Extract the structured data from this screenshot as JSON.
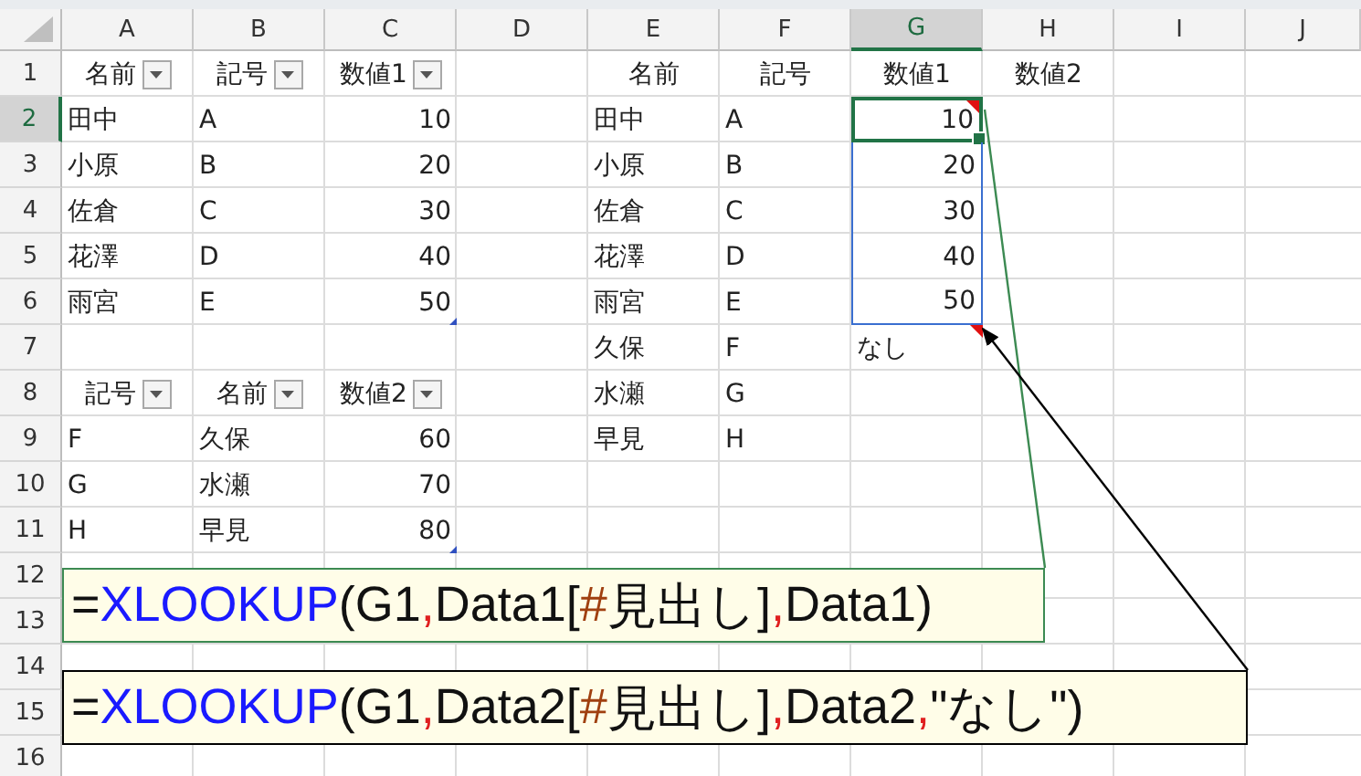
{
  "columns": [
    {
      "label": "A",
      "selected": false
    },
    {
      "label": "B",
      "selected": false
    },
    {
      "label": "C",
      "selected": false
    },
    {
      "label": "D",
      "selected": false
    },
    {
      "label": "E",
      "selected": false
    },
    {
      "label": "F",
      "selected": false
    },
    {
      "label": "G",
      "selected": true
    },
    {
      "label": "H",
      "selected": false
    },
    {
      "label": "I",
      "selected": false
    },
    {
      "label": "J",
      "selected": false
    }
  ],
  "rows": [
    {
      "label": "1",
      "selected": false,
      "cells": {
        "A": {
          "text": "名前",
          "kind": "header",
          "filter": true,
          "selected": false
        },
        "B": {
          "text": "記号",
          "kind": "header",
          "filter": true,
          "selected": false
        },
        "C": {
          "text": "数値1",
          "kind": "header",
          "filter": true,
          "selected": false
        },
        "E": {
          "text": "名前",
          "kind": "header",
          "selected": false
        },
        "F": {
          "text": "記号",
          "kind": "header",
          "selected": false
        },
        "G": {
          "text": "数値1",
          "kind": "header",
          "selected": false
        },
        "H": {
          "text": "数値2",
          "kind": "header",
          "selected": false
        }
      }
    },
    {
      "label": "2",
      "selected": true,
      "cells": {
        "A": {
          "text": "田中",
          "kind": "text",
          "selected": false
        },
        "B": {
          "text": "A",
          "kind": "text",
          "selected": false
        },
        "C": {
          "text": "10",
          "kind": "number",
          "selected": false
        },
        "E": {
          "text": "田中",
          "kind": "text",
          "selected": false
        },
        "F": {
          "text": "A",
          "kind": "text",
          "selected": false
        },
        "G": {
          "text": "10",
          "kind": "number",
          "selected": true,
          "traced": true,
          "flagged": true
        }
      }
    },
    {
      "label": "3",
      "selected": false,
      "cells": {
        "A": {
          "text": "小原",
          "kind": "text",
          "selected": false
        },
        "B": {
          "text": "B",
          "kind": "text",
          "selected": false
        },
        "C": {
          "text": "20",
          "kind": "number",
          "selected": false
        },
        "E": {
          "text": "小原",
          "kind": "text",
          "selected": false
        },
        "F": {
          "text": "B",
          "kind": "text",
          "selected": false
        },
        "G": {
          "text": "20",
          "kind": "number",
          "selected": false,
          "traced": true
        }
      }
    },
    {
      "label": "4",
      "selected": false,
      "cells": {
        "A": {
          "text": "佐倉",
          "kind": "text",
          "selected": false
        },
        "B": {
          "text": "C",
          "kind": "text",
          "selected": false
        },
        "C": {
          "text": "30",
          "kind": "number",
          "selected": false
        },
        "E": {
          "text": "佐倉",
          "kind": "text",
          "selected": false
        },
        "F": {
          "text": "C",
          "kind": "text",
          "selected": false
        },
        "G": {
          "text": "30",
          "kind": "number",
          "selected": false,
          "traced": true
        }
      }
    },
    {
      "label": "5",
      "selected": false,
      "cells": {
        "A": {
          "text": "花澤",
          "kind": "text",
          "selected": false
        },
        "B": {
          "text": "D",
          "kind": "text",
          "selected": false
        },
        "C": {
          "text": "40",
          "kind": "number",
          "selected": false
        },
        "E": {
          "text": "花澤",
          "kind": "text",
          "selected": false
        },
        "F": {
          "text": "D",
          "kind": "text",
          "selected": false
        },
        "G": {
          "text": "40",
          "kind": "number",
          "selected": false,
          "traced": true
        }
      }
    },
    {
      "label": "6",
      "selected": false,
      "cells": {
        "A": {
          "text": "雨宮",
          "kind": "text",
          "selected": false
        },
        "B": {
          "text": "E",
          "kind": "text",
          "selected": false
        },
        "C": {
          "text": "50",
          "kind": "number",
          "selected": false,
          "table_end": true
        },
        "E": {
          "text": "雨宮",
          "kind": "text",
          "selected": false
        },
        "F": {
          "text": "E",
          "kind": "text",
          "selected": false
        },
        "G": {
          "text": "50",
          "kind": "number",
          "selected": false,
          "traced": true
        }
      }
    },
    {
      "label": "7",
      "selected": false,
      "cells": {
        "E": {
          "text": "久保",
          "kind": "text",
          "selected": false
        },
        "F": {
          "text": "F",
          "kind": "text",
          "selected": false
        },
        "G": {
          "text": "なし",
          "kind": "text",
          "selected": false,
          "flagged": true
        }
      }
    },
    {
      "label": "8",
      "selected": false,
      "cells": {
        "A": {
          "text": "記号",
          "kind": "header",
          "filter": true,
          "selected": false
        },
        "B": {
          "text": "名前",
          "kind": "header",
          "filter": true,
          "selected": false
        },
        "C": {
          "text": "数値2",
          "kind": "header",
          "filter": true,
          "selected": false
        },
        "E": {
          "text": "水瀬",
          "kind": "text",
          "selected": false
        },
        "F": {
          "text": "G",
          "kind": "text",
          "selected": false
        }
      }
    },
    {
      "label": "9",
      "selected": false,
      "cells": {
        "A": {
          "text": "F",
          "kind": "text",
          "selected": false
        },
        "B": {
          "text": "久保",
          "kind": "text",
          "selected": false
        },
        "C": {
          "text": "60",
          "kind": "number",
          "selected": false
        },
        "E": {
          "text": "早見",
          "kind": "text",
          "selected": false
        },
        "F": {
          "text": "H",
          "kind": "text",
          "selected": false
        }
      }
    },
    {
      "label": "10",
      "selected": false,
      "cells": {
        "A": {
          "text": "G",
          "kind": "text",
          "selected": false
        },
        "B": {
          "text": "水瀬",
          "kind": "text",
          "selected": false
        },
        "C": {
          "text": "70",
          "kind": "number",
          "selected": false
        }
      }
    },
    {
      "label": "11",
      "selected": false,
      "cells": {
        "A": {
          "text": "H",
          "kind": "text",
          "selected": false
        },
        "B": {
          "text": "早見",
          "kind": "text",
          "selected": false
        },
        "C": {
          "text": "80",
          "kind": "number",
          "selected": false,
          "table_end": true
        }
      }
    },
    {
      "label": "12",
      "selected": false,
      "cells": {}
    },
    {
      "label": "13",
      "selected": false,
      "cells": {}
    },
    {
      "label": "14",
      "selected": false,
      "cells": {}
    },
    {
      "label": "15",
      "selected": false,
      "cells": {}
    },
    {
      "label": "16",
      "selected": false,
      "cells": {}
    }
  ],
  "callouts": [
    {
      "color": "#3c8a52",
      "kind": "line",
      "parts": [
        {
          "kind": "plain",
          "text": "="
        },
        {
          "kind": "function",
          "text": "XLOOKUP"
        },
        {
          "kind": "plain",
          "text": "(G1"
        },
        {
          "kind": "separator",
          "text": ","
        },
        {
          "kind": "plain",
          "text": "Data1["
        },
        {
          "kind": "hash",
          "text": "#"
        },
        {
          "kind": "plain",
          "text": "見出し]"
        },
        {
          "kind": "separator",
          "text": ","
        },
        {
          "kind": "plain",
          "text": "Data1)"
        }
      ]
    },
    {
      "color": "#000000",
      "kind": "arrow",
      "parts": [
        {
          "kind": "plain",
          "text": "="
        },
        {
          "kind": "function",
          "text": "XLOOKUP"
        },
        {
          "kind": "plain",
          "text": "(G1"
        },
        {
          "kind": "separator",
          "text": ","
        },
        {
          "kind": "plain",
          "text": "Data2["
        },
        {
          "kind": "hash",
          "text": "#"
        },
        {
          "kind": "plain",
          "text": "見出し]"
        },
        {
          "kind": "separator",
          "text": ","
        },
        {
          "kind": "plain",
          "text": "Data2"
        },
        {
          "kind": "separator",
          "text": ","
        },
        {
          "kind": "plain",
          "text": "\"なし\")"
        }
      ]
    }
  ]
}
